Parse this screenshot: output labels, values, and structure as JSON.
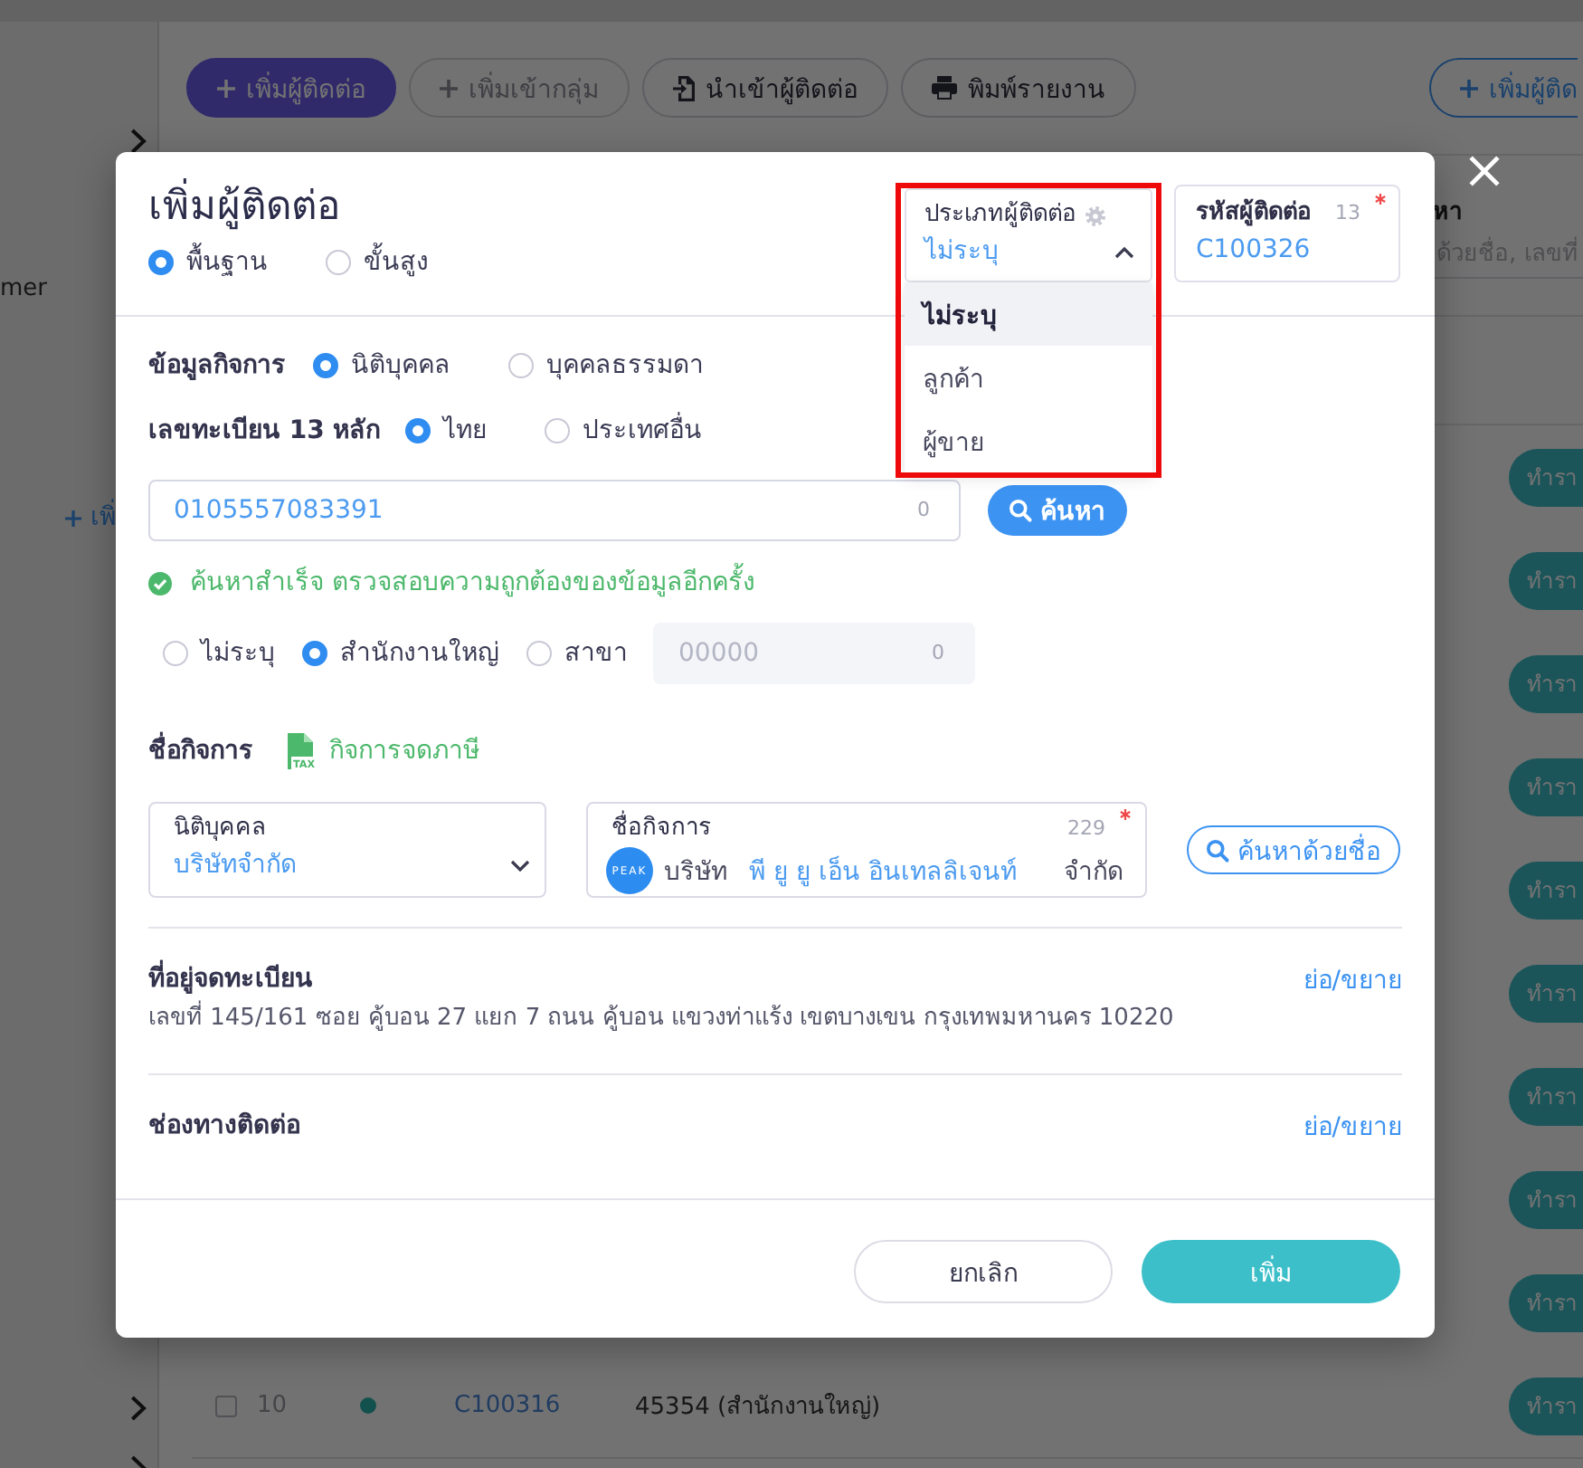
{
  "background": {
    "sidebar": {
      "label": "mer",
      "link": "เพิ่"
    },
    "toolbar": {
      "buttons": [
        {
          "label": "เพิ่มผู้ติดต่อ",
          "kind": "add",
          "disabled": false
        },
        {
          "label": "เพิ่มเข้ากลุ่ม",
          "kind": "group",
          "disabled": true
        },
        {
          "label": "นำเข้าผู้ติดต่อ",
          "kind": "import",
          "disabled": false
        },
        {
          "label": "พิมพ์รายงาน",
          "kind": "print",
          "disabled": false
        }
      ],
      "right_button": "เพิ่มผู้ติด"
    },
    "search": {
      "label": "หา",
      "placeholder": "ด้วยชื่อ, เลขที่"
    },
    "table": {
      "rows": [
        {
          "action": "ทำรา"
        },
        {
          "action": "ทำรา"
        },
        {
          "action": "ทำรา"
        },
        {
          "action": "ทำรา"
        },
        {
          "action": "ทำรา"
        },
        {
          "action": "ทำรา"
        },
        {
          "action": "ทำรา"
        },
        {
          "action": "ทำรา"
        },
        {
          "action": "ทำรา"
        },
        {
          "checked": false,
          "number": "10",
          "code": "C100316",
          "name": "45354 (สำนักงานใหญ่)",
          "action": "ทำรา"
        }
      ]
    }
  },
  "modal": {
    "title": "เพิ่มผู้ติดต่อ",
    "modes": [
      {
        "label": "พื้นฐาน",
        "selected": true
      },
      {
        "label": "ขั้นสูง",
        "selected": false
      }
    ],
    "contact_type": {
      "label": "ประเภทผู้ติดต่อ",
      "value": "ไม่ระบุ",
      "expanded": true,
      "highlighted": true,
      "options": [
        {
          "label": "ไม่ระบุ",
          "selected": true
        },
        {
          "label": "ลูกค้า",
          "selected": false
        },
        {
          "label": "ผู้ขาย",
          "selected": false
        }
      ]
    },
    "contact_code": {
      "label": "รหัสผู้ติดต่อ",
      "counter": "13",
      "required": true,
      "value": "C100326"
    },
    "business_type": {
      "label": "ข้อมูลกิจการ",
      "options": [
        {
          "label": "นิติบุคคล",
          "selected": true
        },
        {
          "label": "บุคคลธรรมดา",
          "selected": false
        }
      ]
    },
    "registration": {
      "label": "เลขทะเบียน 13 หลัก",
      "options": [
        {
          "label": "ไทย",
          "selected": true
        },
        {
          "label": "ประเทศอื่น",
          "selected": false
        }
      ],
      "value": "0105557083391",
      "counter": "0",
      "search_button": "ค้นหา"
    },
    "search_result": "ค้นหาสำเร็จ ตรวจสอบความถูกต้องของข้อมูลอีกครั้ง",
    "branch": {
      "options": [
        {
          "label": "ไม่ระบุ",
          "selected": false
        },
        {
          "label": "สำนักงานใหญ่",
          "selected": true
        },
        {
          "label": "สาขา",
          "selected": false
        }
      ],
      "placeholder": "00000",
      "counter": "0",
      "disabled": true
    },
    "business_name": {
      "label": "ชื่อกิจการ",
      "tax_icon_text": "TAX",
      "tax_status": "กิจการจดภาษี",
      "entity": {
        "label": "นิติบุคคล",
        "value": "บริษัทจำกัด"
      },
      "name": {
        "label": "ชื่อกิจการ",
        "counter": "229",
        "required": true,
        "logo": "PEAK",
        "prefix": "บริษัท",
        "value": "พี ยู ยู เอ็น อินเทลลิเจนท์",
        "suffix": "จำกัด"
      },
      "search_button": "ค้นหาด้วยชื่อ"
    },
    "sections": [
      {
        "title": "ที่อยู่จดทะเบียน",
        "toggle": "ย่อ/ขยาย",
        "text": "เลขที่ 145/161 ซอย คู้บอน 27 แยก 7 ถนน คู้บอน แขวงท่าแร้ง เขตบางเขน กรุงเทพมหานคร 10220"
      },
      {
        "title": "ช่องทางติดต่อ",
        "toggle": "ย่อ/ขยาย"
      }
    ],
    "buttons": [
      {
        "label": "ยกเลิก",
        "kind": "cancel"
      },
      {
        "label": "เพิ่ม",
        "kind": "submit"
      }
    ]
  }
}
